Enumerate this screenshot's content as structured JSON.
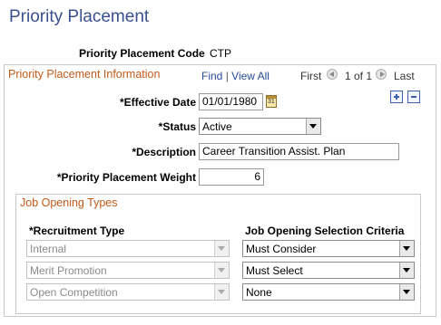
{
  "page": {
    "title": "Priority Placement"
  },
  "header": {
    "code_label": "Priority Placement Code",
    "code_value": "CTP"
  },
  "section": {
    "title": "Priority Placement Information",
    "find": "Find",
    "sep": "|",
    "view_all": "View All",
    "first": "First",
    "range": "1 of 1",
    "last": "Last",
    "add_symbol": "+",
    "remove_symbol": "−"
  },
  "fields": {
    "effective_date_label": "*Effective Date",
    "effective_date_value": "01/01/1980",
    "status_label": "*Status",
    "status_value": "Active",
    "description_label": "*Description",
    "description_value": "Career Transition Assist. Plan",
    "weight_label": "*Priority Placement Weight",
    "weight_value": "6"
  },
  "job_opening_types": {
    "title": "Job Opening Types",
    "col_recruitment": "*Recruitment Type",
    "col_criteria": "Job Opening Selection Criteria",
    "rows": [
      {
        "recruitment": "Internal",
        "criteria": "Must Consider"
      },
      {
        "recruitment": "Merit Promotion",
        "criteria": "Must Select"
      },
      {
        "recruitment": "Open Competition",
        "criteria": "None"
      }
    ]
  },
  "colors": {
    "title": "#3a4f8f",
    "section_title": "#c15a1a",
    "link": "#2a4b96"
  },
  "icons": [
    "prev-icon",
    "next-icon",
    "add-row-icon",
    "delete-row-icon",
    "calendar-icon"
  ]
}
